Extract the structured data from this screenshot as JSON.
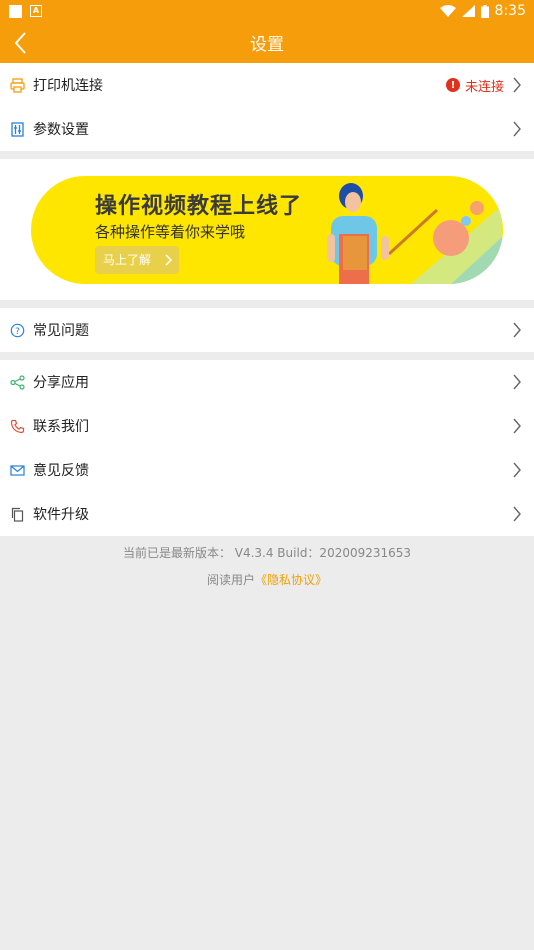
{
  "status_bar": {
    "time": "8:35"
  },
  "header": {
    "title": "设置"
  },
  "section1": {
    "items": [
      {
        "label": "打印机连接",
        "status": "未连接"
      },
      {
        "label": "参数设置"
      }
    ]
  },
  "banner": {
    "title": "操作视频教程上线了",
    "subtitle": "各种操作等着你来学哦",
    "button": "马上了解"
  },
  "section2": {
    "items": [
      {
        "label": "常见问题"
      }
    ]
  },
  "section3": {
    "items": [
      {
        "label": "分享应用"
      },
      {
        "label": "联系我们"
      },
      {
        "label": "意见反馈"
      },
      {
        "label": "软件升级"
      }
    ]
  },
  "footer": {
    "version": "当前已是最新版本： V4.3.4    Build：202009231653",
    "privacy_prefix": "阅读用户",
    "privacy_link": "《隐私协议》"
  },
  "colors": {
    "accent": "#f59d0b",
    "warning": "#e0301e",
    "link": "#f0a000",
    "banner": "#ffe600"
  }
}
